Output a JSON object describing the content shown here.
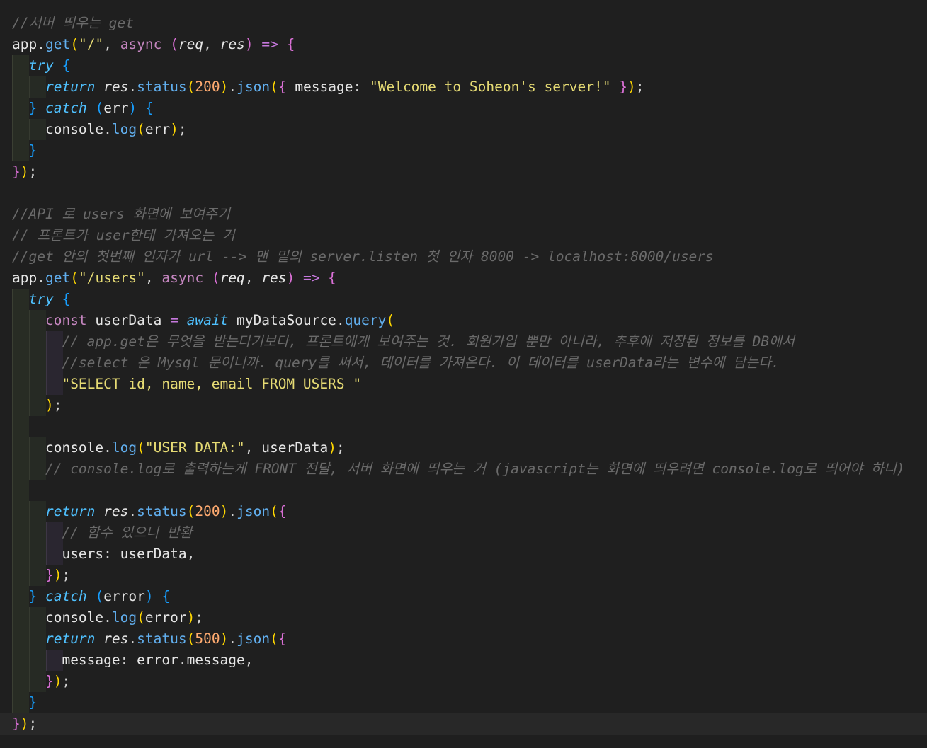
{
  "editor": {
    "colors": {
      "background": "#1f1f1f",
      "comment": "#6a6a6a",
      "keyword": "#c586c0",
      "function": "#61afef",
      "string": "#e6db74",
      "number": "#ffab70"
    },
    "lines": [
      {
        "indent": 0,
        "segs": [
          [
            "cm",
            "//서버 띄우는 get"
          ]
        ]
      },
      {
        "indent": 0,
        "segs": [
          [
            "var",
            "app"
          ],
          [
            "pl",
            "."
          ],
          [
            "fn",
            "get"
          ],
          [
            "p1",
            "("
          ],
          [
            "str",
            "\"/\""
          ],
          [
            "pl",
            ", "
          ],
          [
            "kw",
            "async"
          ],
          [
            "pl",
            " "
          ],
          [
            "p2",
            "("
          ],
          [
            "prm",
            "req"
          ],
          [
            "pl",
            ", "
          ],
          [
            "prm",
            "res"
          ],
          [
            "p2",
            ")"
          ],
          [
            "pl",
            " "
          ],
          [
            "op",
            "=>"
          ],
          [
            "pl",
            " "
          ],
          [
            "p2",
            "{"
          ]
        ]
      },
      {
        "indent": 1,
        "segs": [
          [
            "ctl",
            "try"
          ],
          [
            "pl",
            " "
          ],
          [
            "p3",
            "{"
          ]
        ]
      },
      {
        "indent": 2,
        "segs": [
          [
            "ctl",
            "return"
          ],
          [
            "pl",
            " "
          ],
          [
            "vari",
            "res"
          ],
          [
            "pl",
            "."
          ],
          [
            "fn",
            "status"
          ],
          [
            "p1",
            "("
          ],
          [
            "num",
            "200"
          ],
          [
            "p1",
            ")"
          ],
          [
            "pl",
            "."
          ],
          [
            "fn",
            "json"
          ],
          [
            "p1",
            "("
          ],
          [
            "p2",
            "{"
          ],
          [
            "pl",
            " "
          ],
          [
            "var",
            "message"
          ],
          [
            "pl",
            ": "
          ],
          [
            "str",
            "\"Welcome to Soheon's server!\""
          ],
          [
            "pl",
            " "
          ],
          [
            "p2",
            "}"
          ],
          [
            "p1",
            ")"
          ],
          [
            "pl",
            ";"
          ]
        ]
      },
      {
        "indent": 1,
        "segs": [
          [
            "p3",
            "}"
          ],
          [
            "pl",
            " "
          ],
          [
            "ctl",
            "catch"
          ],
          [
            "pl",
            " "
          ],
          [
            "p3",
            "("
          ],
          [
            "var",
            "err"
          ],
          [
            "p3",
            ")"
          ],
          [
            "pl",
            " "
          ],
          [
            "p3",
            "{"
          ]
        ]
      },
      {
        "indent": 2,
        "segs": [
          [
            "var",
            "console"
          ],
          [
            "pl",
            "."
          ],
          [
            "fn",
            "log"
          ],
          [
            "p1",
            "("
          ],
          [
            "var",
            "err"
          ],
          [
            "p1",
            ")"
          ],
          [
            "pl",
            ";"
          ]
        ]
      },
      {
        "indent": 1,
        "segs": [
          [
            "p3",
            "}"
          ]
        ]
      },
      {
        "indent": 0,
        "segs": [
          [
            "p2",
            "}"
          ],
          [
            "p1",
            ")"
          ],
          [
            "pl",
            ";"
          ]
        ]
      },
      {
        "indent": 0,
        "segs": []
      },
      {
        "indent": 0,
        "segs": [
          [
            "cm",
            "//API 로 users 화면에 보여주기"
          ]
        ]
      },
      {
        "indent": 0,
        "segs": [
          [
            "cm",
            "// 프론트가 user한테 가져오는 거"
          ]
        ]
      },
      {
        "indent": 0,
        "segs": [
          [
            "cm",
            "//get 안의 첫번째 인자가 url --> 맨 밑의 server.listen 첫 인자 8000 -> localhost:8000/users"
          ]
        ]
      },
      {
        "indent": 0,
        "segs": [
          [
            "var",
            "app"
          ],
          [
            "pl",
            "."
          ],
          [
            "fn",
            "get"
          ],
          [
            "p1",
            "("
          ],
          [
            "str",
            "\"/users\""
          ],
          [
            "pl",
            ", "
          ],
          [
            "kw",
            "async"
          ],
          [
            "pl",
            " "
          ],
          [
            "p2",
            "("
          ],
          [
            "prm",
            "req"
          ],
          [
            "pl",
            ", "
          ],
          [
            "prm",
            "res"
          ],
          [
            "p2",
            ")"
          ],
          [
            "pl",
            " "
          ],
          [
            "op",
            "=>"
          ],
          [
            "pl",
            " "
          ],
          [
            "p2",
            "{"
          ]
        ]
      },
      {
        "indent": 1,
        "segs": [
          [
            "ctl",
            "try"
          ],
          [
            "pl",
            " "
          ],
          [
            "p3",
            "{"
          ]
        ]
      },
      {
        "indent": 2,
        "segs": [
          [
            "kw",
            "const"
          ],
          [
            "pl",
            " "
          ],
          [
            "var",
            "userData"
          ],
          [
            "pl",
            " "
          ],
          [
            "op",
            "="
          ],
          [
            "pl",
            " "
          ],
          [
            "ctl",
            "await"
          ],
          [
            "pl",
            " "
          ],
          [
            "var",
            "myDataSource"
          ],
          [
            "pl",
            "."
          ],
          [
            "fn",
            "query"
          ],
          [
            "p1",
            "("
          ]
        ]
      },
      {
        "indent": 3,
        "segs": [
          [
            "cm",
            "// app.get은 무엇을 받는다기보다, 프론트에게 보여주는 것. 회원가입 뿐만 아니라, 추후에 저장된 정보를 DB에서"
          ]
        ]
      },
      {
        "indent": 3,
        "segs": [
          [
            "cm",
            "//select 은 Mysql 문이니까. query를 써서, 데이터를 가져온다. 이 데이터를 userData라는 변수에 담는다."
          ]
        ]
      },
      {
        "indent": 3,
        "segs": [
          [
            "str",
            "\"SELECT id, name, email FROM USERS \""
          ]
        ]
      },
      {
        "indent": 2,
        "segs": [
          [
            "p1",
            ")"
          ],
          [
            "pl",
            ";"
          ]
        ]
      },
      {
        "indent": 1,
        "segs": []
      },
      {
        "indent": 2,
        "segs": [
          [
            "var",
            "console"
          ],
          [
            "pl",
            "."
          ],
          [
            "fn",
            "log"
          ],
          [
            "p1",
            "("
          ],
          [
            "str",
            "\"USER DATA:\""
          ],
          [
            "pl",
            ", "
          ],
          [
            "var",
            "userData"
          ],
          [
            "p1",
            ")"
          ],
          [
            "pl",
            ";"
          ]
        ]
      },
      {
        "indent": 2,
        "segs": [
          [
            "cm",
            "// console.log로 출력하는게 FRONT 전달, 서버 화면에 띄우는 거 (javascript는 화면에 띄우려면 console.log로 띄어야 하니)"
          ]
        ]
      },
      {
        "indent": 1,
        "segs": []
      },
      {
        "indent": 2,
        "segs": [
          [
            "ctl",
            "return"
          ],
          [
            "pl",
            " "
          ],
          [
            "vari",
            "res"
          ],
          [
            "pl",
            "."
          ],
          [
            "fn",
            "status"
          ],
          [
            "p1",
            "("
          ],
          [
            "num",
            "200"
          ],
          [
            "p1",
            ")"
          ],
          [
            "pl",
            "."
          ],
          [
            "fn",
            "json"
          ],
          [
            "p1",
            "("
          ],
          [
            "p2",
            "{"
          ]
        ]
      },
      {
        "indent": 3,
        "segs": [
          [
            "cm",
            "// 함수 있으니 반환"
          ]
        ]
      },
      {
        "indent": 3,
        "segs": [
          [
            "var",
            "users"
          ],
          [
            "pl",
            ": "
          ],
          [
            "var",
            "userData"
          ],
          [
            "pl",
            ","
          ]
        ]
      },
      {
        "indent": 2,
        "segs": [
          [
            "p2",
            "}"
          ],
          [
            "p1",
            ")"
          ],
          [
            "pl",
            ";"
          ]
        ]
      },
      {
        "indent": 1,
        "segs": [
          [
            "p3",
            "}"
          ],
          [
            "pl",
            " "
          ],
          [
            "ctl",
            "catch"
          ],
          [
            "pl",
            " "
          ],
          [
            "p3",
            "("
          ],
          [
            "var",
            "error"
          ],
          [
            "p3",
            ")"
          ],
          [
            "pl",
            " "
          ],
          [
            "p3",
            "{"
          ]
        ]
      },
      {
        "indent": 2,
        "segs": [
          [
            "var",
            "console"
          ],
          [
            "pl",
            "."
          ],
          [
            "fn",
            "log"
          ],
          [
            "p1",
            "("
          ],
          [
            "var",
            "error"
          ],
          [
            "p1",
            ")"
          ],
          [
            "pl",
            ";"
          ]
        ]
      },
      {
        "indent": 2,
        "segs": [
          [
            "ctl",
            "return"
          ],
          [
            "pl",
            " "
          ],
          [
            "vari",
            "res"
          ],
          [
            "pl",
            "."
          ],
          [
            "fn",
            "status"
          ],
          [
            "p1",
            "("
          ],
          [
            "num",
            "500"
          ],
          [
            "p1",
            ")"
          ],
          [
            "pl",
            "."
          ],
          [
            "fn",
            "json"
          ],
          [
            "p1",
            "("
          ],
          [
            "p2",
            "{"
          ]
        ]
      },
      {
        "indent": 3,
        "segs": [
          [
            "var",
            "message"
          ],
          [
            "pl",
            ": "
          ],
          [
            "var",
            "error"
          ],
          [
            "pl",
            "."
          ],
          [
            "var",
            "message"
          ],
          [
            "pl",
            ","
          ]
        ]
      },
      {
        "indent": 2,
        "segs": [
          [
            "p2",
            "}"
          ],
          [
            "p1",
            ")"
          ],
          [
            "pl",
            ";"
          ]
        ]
      },
      {
        "indent": 1,
        "segs": [
          [
            "p3",
            "}"
          ]
        ]
      },
      {
        "indent": 0,
        "segs": [
          [
            "p2",
            "}"
          ],
          [
            "p1",
            ")"
          ],
          [
            "pl",
            ";"
          ]
        ],
        "current": true
      }
    ]
  }
}
